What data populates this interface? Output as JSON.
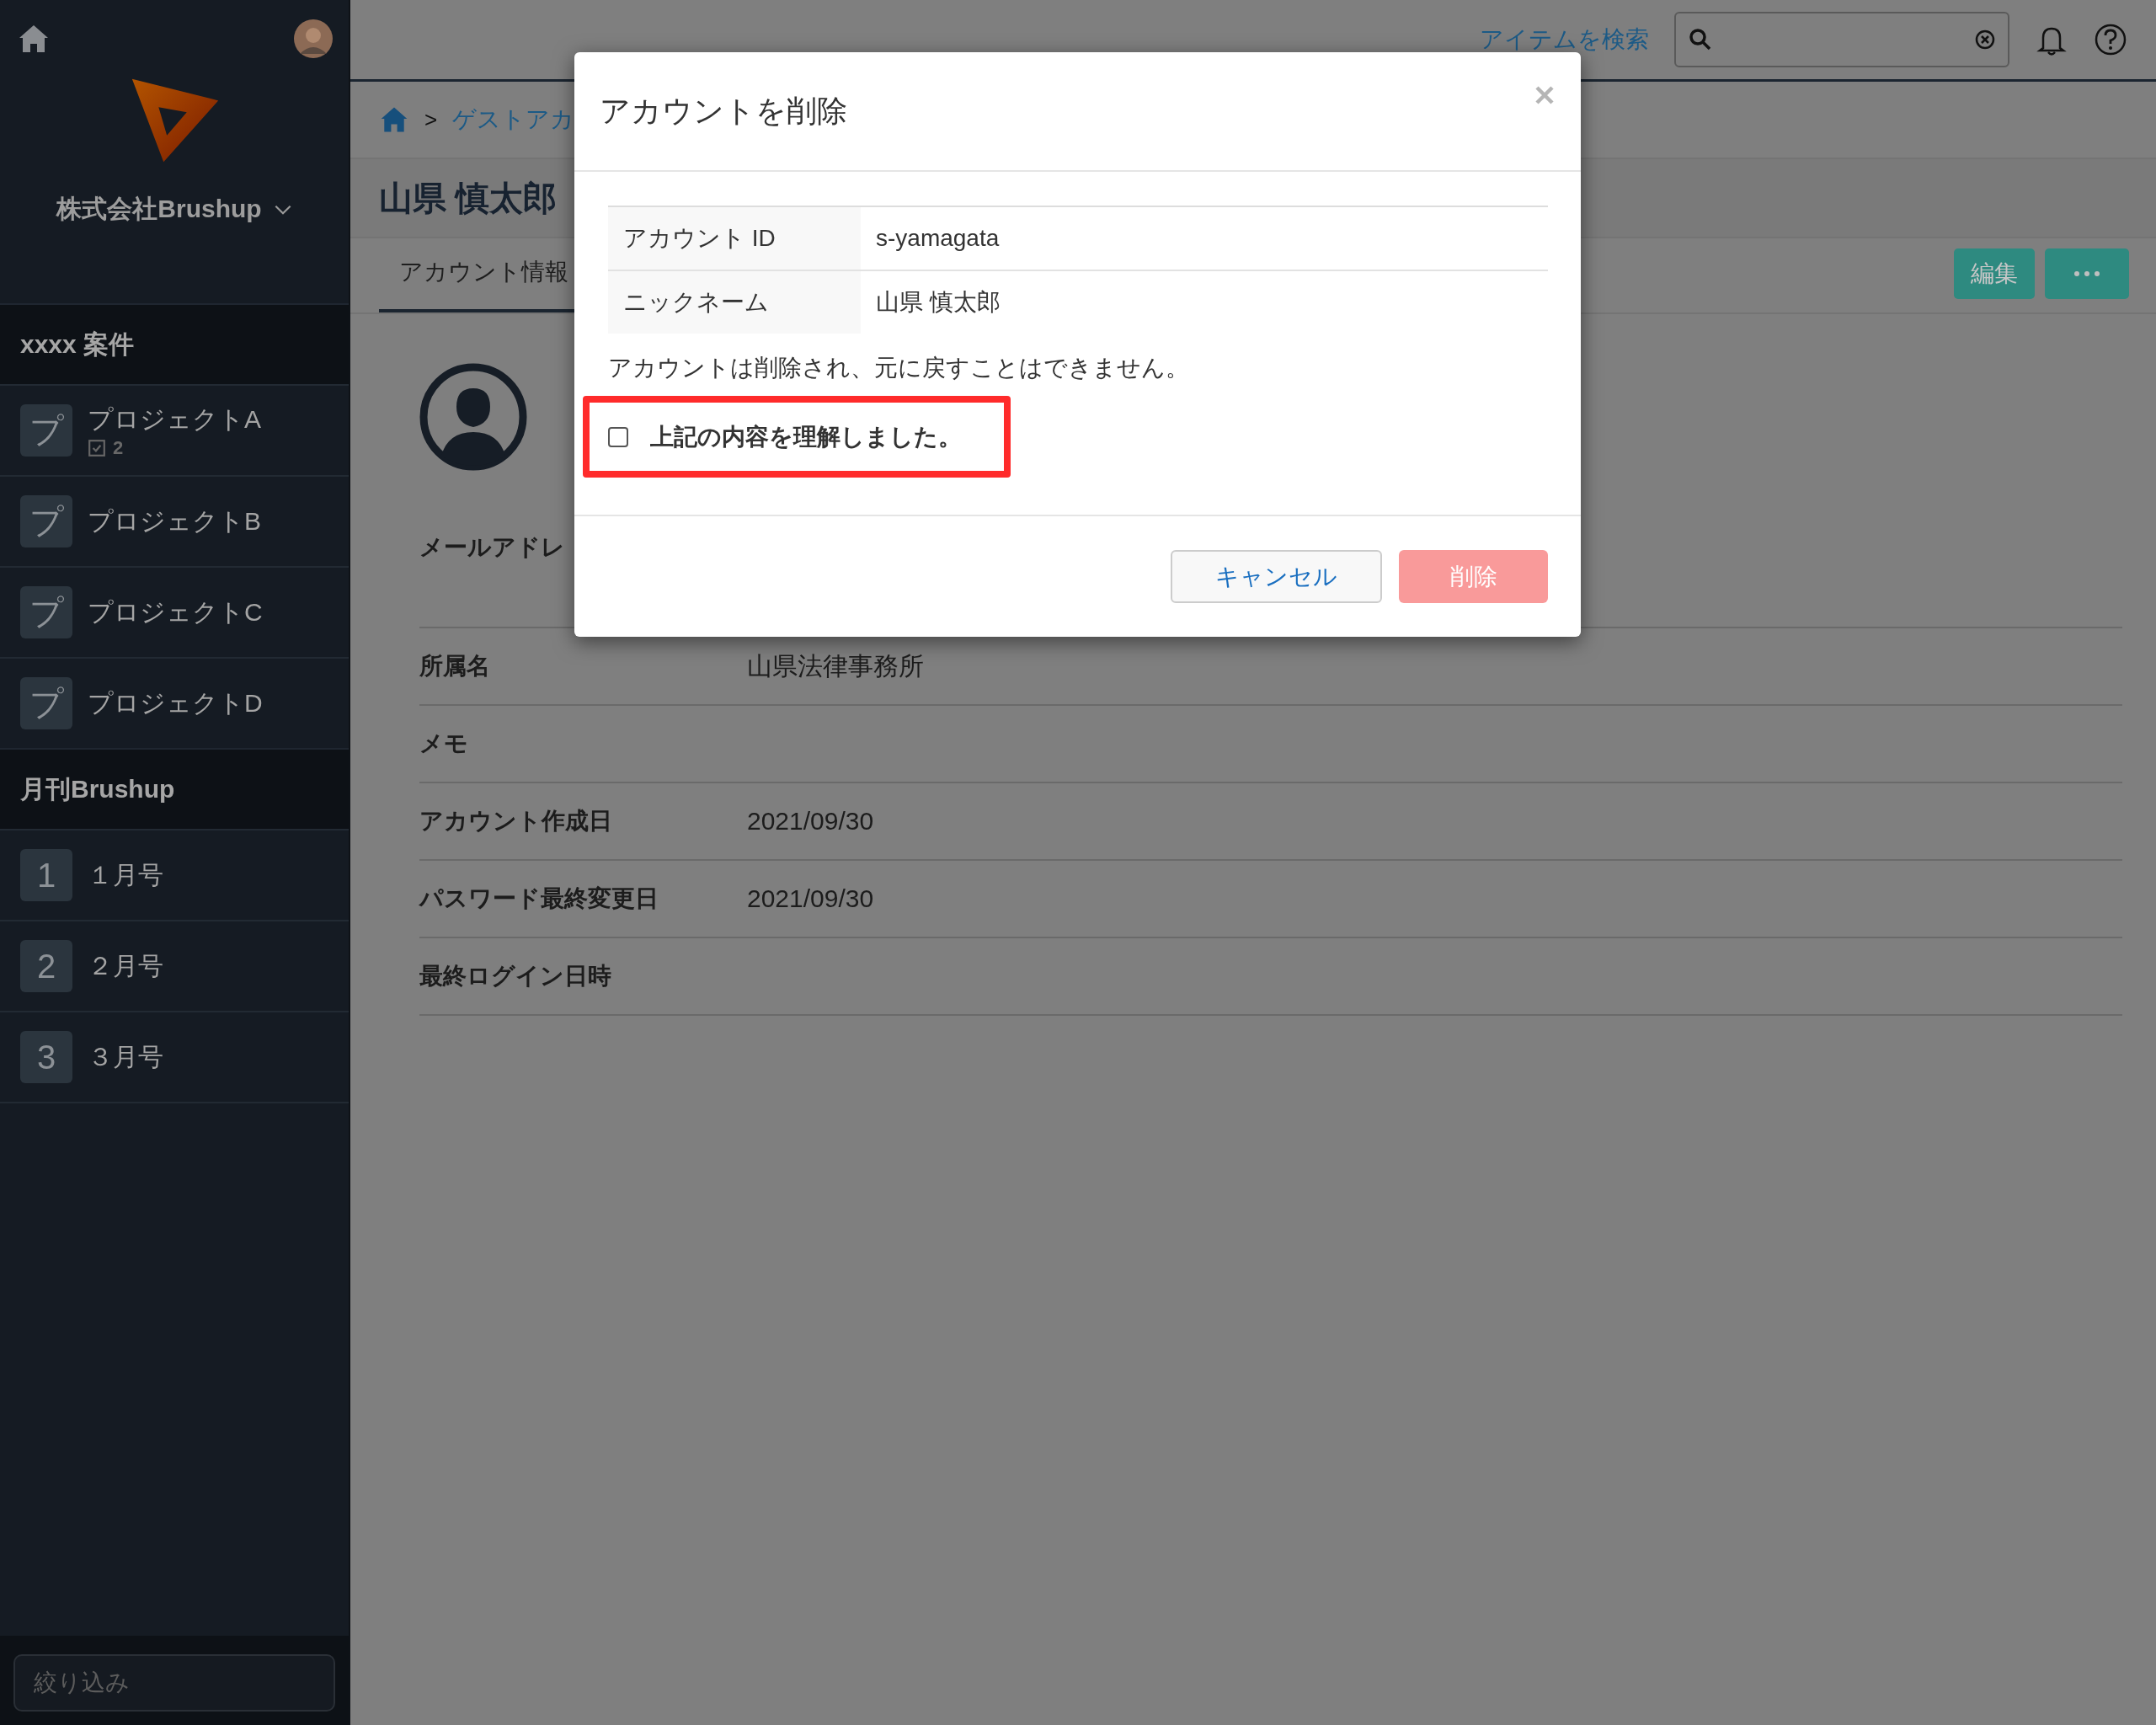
{
  "sidebar": {
    "company": "株式会社Brushup",
    "sections": [
      {
        "title": "xxxx 案件",
        "items": [
          {
            "icon_text": "プ",
            "label": "プロジェクトA",
            "count": "2"
          },
          {
            "icon_text": "プ",
            "label": "プロジェクトB"
          },
          {
            "icon_text": "プ",
            "label": "プロジェクトC"
          },
          {
            "icon_text": "プ",
            "label": "プロジェクトD"
          }
        ]
      },
      {
        "title": "月刊Brushup",
        "items": [
          {
            "icon_text": "1",
            "label": "１月号"
          },
          {
            "icon_text": "2",
            "label": "２月号"
          },
          {
            "icon_text": "3",
            "label": "３月号"
          }
        ]
      }
    ],
    "filter": {
      "placeholder": "絞り込み"
    }
  },
  "topbar": {
    "search_link": "アイテムを検索"
  },
  "breadcrumb": {
    "separator": ">",
    "items": [
      "ゲストアカ"
    ]
  },
  "page_title": "山県 慎太郎",
  "tabs": [
    {
      "label": "アカウント情報",
      "selected": true
    }
  ],
  "action_buttons": [
    {
      "kind": "edit",
      "label": "編集"
    },
    {
      "kind": "more"
    }
  ],
  "profile_fields": [
    {
      "label": "メールアドレ"
    },
    {
      "label": "所属名",
      "value": "山県法律事務所"
    },
    {
      "label": "メモ"
    },
    {
      "label": "アカウント作成日",
      "value": "2021/09/30"
    },
    {
      "label": "パスワード最終変更日",
      "value": "2021/09/30"
    },
    {
      "label": "最終ログイン日時"
    }
  ],
  "dialog": {
    "title": "アカウントを削除",
    "details": [
      {
        "label": "アカウント ID",
        "value": "s-yamagata"
      },
      {
        "label": "ニックネーム",
        "value": "山県 慎太郎"
      }
    ],
    "message": "アカウントは削除され、元に戻すことはできません。",
    "confirm": {
      "label": "上記の内容を理解しました。",
      "checked": false
    },
    "buttons": [
      {
        "kind": "cancel",
        "label": "キャンセル",
        "disabled": false
      },
      {
        "kind": "delete",
        "label": "削除",
        "disabled": true
      }
    ]
  }
}
